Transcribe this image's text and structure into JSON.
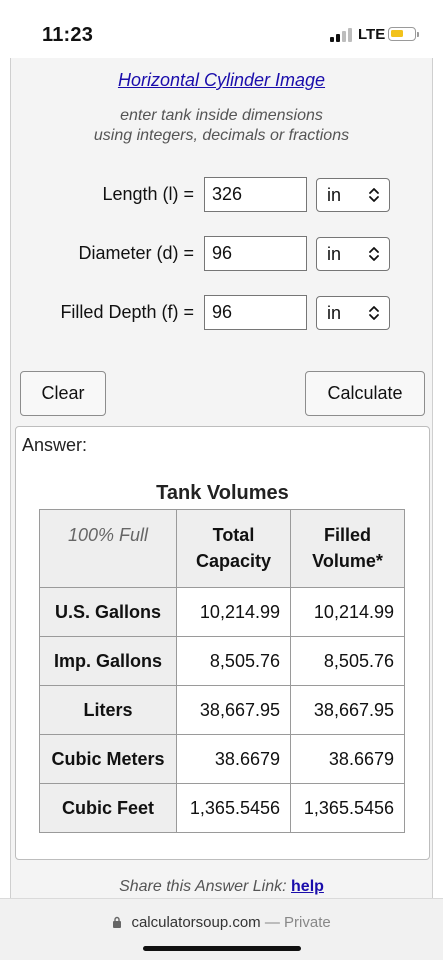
{
  "status": {
    "time": "11:23",
    "network": "LTE"
  },
  "page": {
    "image_link": "Horizontal Cylinder Image",
    "instructions": [
      "enter tank inside dimensions",
      "using integers, decimals or fractions"
    ]
  },
  "fields": [
    {
      "label": "Length (l) =",
      "value": "326",
      "unit": "in"
    },
    {
      "label": "Diameter (d) =",
      "value": "96",
      "unit": "in"
    },
    {
      "label": "Filled Depth (f) =",
      "value": "96",
      "unit": "in"
    }
  ],
  "buttons": {
    "clear": "Clear",
    "calculate": "Calculate"
  },
  "answer": {
    "label": "Answer:",
    "table_title": "Tank Volumes",
    "headers": {
      "corner": "100% Full",
      "col1_line1": "Total",
      "col1_line2": "Capacity",
      "col2_line1": "Filled",
      "col2_line2": "Volume*"
    },
    "rows": [
      {
        "name": "U.S. Gallons",
        "total": "10,214.99",
        "filled": "10,214.99"
      },
      {
        "name": "Imp. Gallons",
        "total": "8,505.76",
        "filled": "8,505.76"
      },
      {
        "name": "Liters",
        "total": "38,667.95",
        "filled": "38,667.95"
      },
      {
        "name": "Cubic Meters",
        "total": "38.6679",
        "filled": "38.6679"
      },
      {
        "name": "Cubic Feet",
        "total": "1,365.5456",
        "filled": "1,365.5456"
      }
    ]
  },
  "share": {
    "text": "Share this Answer Link:",
    "link": "help"
  },
  "browser": {
    "domain": "calculatorsoup.com",
    "mode": "— Private"
  }
}
